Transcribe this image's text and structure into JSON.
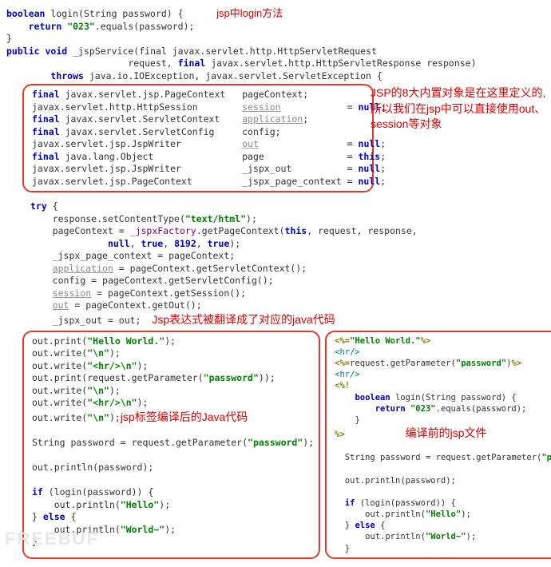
{
  "loginMethod": {
    "sig_kw_boolean": "boolean",
    "sig_name": "login",
    "sig_params": "(String password) {",
    "ret_kw": "return",
    "ret_str": "\"023\"",
    "ret_call": ".equals(password);",
    "close": "}",
    "annotation": "jsp中login方法"
  },
  "serviceSig": {
    "kw_public": "public",
    "kw_void": "void",
    "name": "_jspService",
    "params1": "(final javax.servlet.http.HttpServletRequest",
    "params2": "request, ",
    "kw_final": "final",
    "params3": " javax.servlet.http.HttpServletResponse response)",
    "kw_throws": "throws",
    "throws_rest": " java.io.IOException, javax.servlet.ServletException {"
  },
  "objectsBox": {
    "lines": [
      "final javax.servlet.jsp.PageContext   pageContext;",
      "javax.servlet.http.HttpSession        session            = null;",
      "final javax.servlet.ServletContext    application;",
      "final javax.servlet.ServletConfig     config;",
      "javax.servlet.jsp.JspWriter           out                = null;",
      "final java.lang.Object                page               = this;",
      "javax.servlet.jsp.JspWriter           _jspx_out          = null;",
      "javax.servlet.jsp.PageContext         _jspx_page_context = null;"
    ],
    "sideNote": "JSP的8大内置对象是在这里定义的,所以我们在jsp中可以直接使用out、session等对象"
  },
  "tryBlock": {
    "try_kw": "try",
    "open": " {",
    "l1a": "response.setContentType(",
    "l1s": "\"text/html\"",
    "l1b": ");",
    "l2a": "pageContext = ",
    "l2f": "_jspxFactory",
    "l2b": ".getPageContext(",
    "l2kw": "this",
    "l2c": ", request, response,",
    "l3a": "null",
    "l3b": ", ",
    "l3c": "true",
    "l3d": ", ",
    "l3n": "8192",
    "l3e": ", ",
    "l3f": "true",
    "l3g": ");",
    "l4": "_jspx_page_context = pageContext;",
    "l5u": "application",
    "l5b": " = pageContext.getServletContext();",
    "l6": "config = pageContext.getServletConfig();",
    "l7u": "session",
    "l7b": " = pageContext.getSession();",
    "l8u": "out",
    "l8b": " = pageContext.getOut();",
    "l9": "_jspx_out = out;",
    "annotation": "Jsp表达式被翻译成了对应的java代码"
  },
  "leftBox": {
    "l1a": "out.print(",
    "l1s": "\"Hello World.\"",
    "l1b": ");",
    "l2a": "out.write(",
    "l2s": "\"\\n\"",
    "l2b": ");",
    "l3a": "out.write(",
    "l3s": "\"<hr/>\\n\"",
    "l3b": ");",
    "l4a": "out.print(request.getParameter(",
    "l4s": "\"password\"",
    "l4b": "));",
    "l5a": "out.write(",
    "l5s": "\"\\n\"",
    "l5b": ");",
    "l6a": "out.write(",
    "l6s": "\"<hr/>\\n\"",
    "l6b": ");",
    "l7a": "out.write(",
    "l7s": "\"\\n\"",
    "l7b": ");",
    "annotation": "jsp标签编译后的Java代码",
    "l8a": "String password = request.getParameter(",
    "l8s": "\"password\"",
    "l8b": ");",
    "l9": "out.println(password);",
    "if_kw": "if",
    "if_cond": " (login(password)) {",
    "if_body_a": "out.println(",
    "if_body_s": "\"Hello\"",
    "if_body_b": ");",
    "else_kw": "else",
    "else_open": " {",
    "else_body_a": "out.println(",
    "else_body_s": "\"World~\"",
    "else_body_b": ");",
    "close1": "}",
    "close2": "}"
  },
  "rightBox": {
    "r1a": "<%=",
    "r1s": "\"Hello World.\"",
    "r1b": "%>",
    "r2": "<hr/>",
    "r3a": "<%=",
    "r3m": "request.getParameter(",
    "r3s": "\"password\"",
    "r3c": ")",
    "r3b": "%>",
    "r4": "<hr/>",
    "r5": "<%!",
    "r6kw": "boolean",
    "r6name": " login(String password) {",
    "r7kw": "return",
    "r7s": "\"023\"",
    "r7b": ".equals(password);",
    "r8": "}",
    "r9": "%>",
    "annotation": "编译前的jsp文件",
    "r10a": "String password = request.getParameter(",
    "r10s": "\"password\"",
    "r10b": ");",
    "r11": "out.println(password);",
    "if_kw": "if",
    "if_cond": " (login(password)) {",
    "if_body_a": "out.println(",
    "if_body_s": "\"Hello\"",
    "if_body_b": ");",
    "else_kw": "else",
    "else_open": " {",
    "else_body_a": "out.println(",
    "else_body_s": "\"World~\"",
    "else_body_b": ");",
    "close1": "}",
    "close2": "}"
  },
  "watermark": "FREEBUF"
}
